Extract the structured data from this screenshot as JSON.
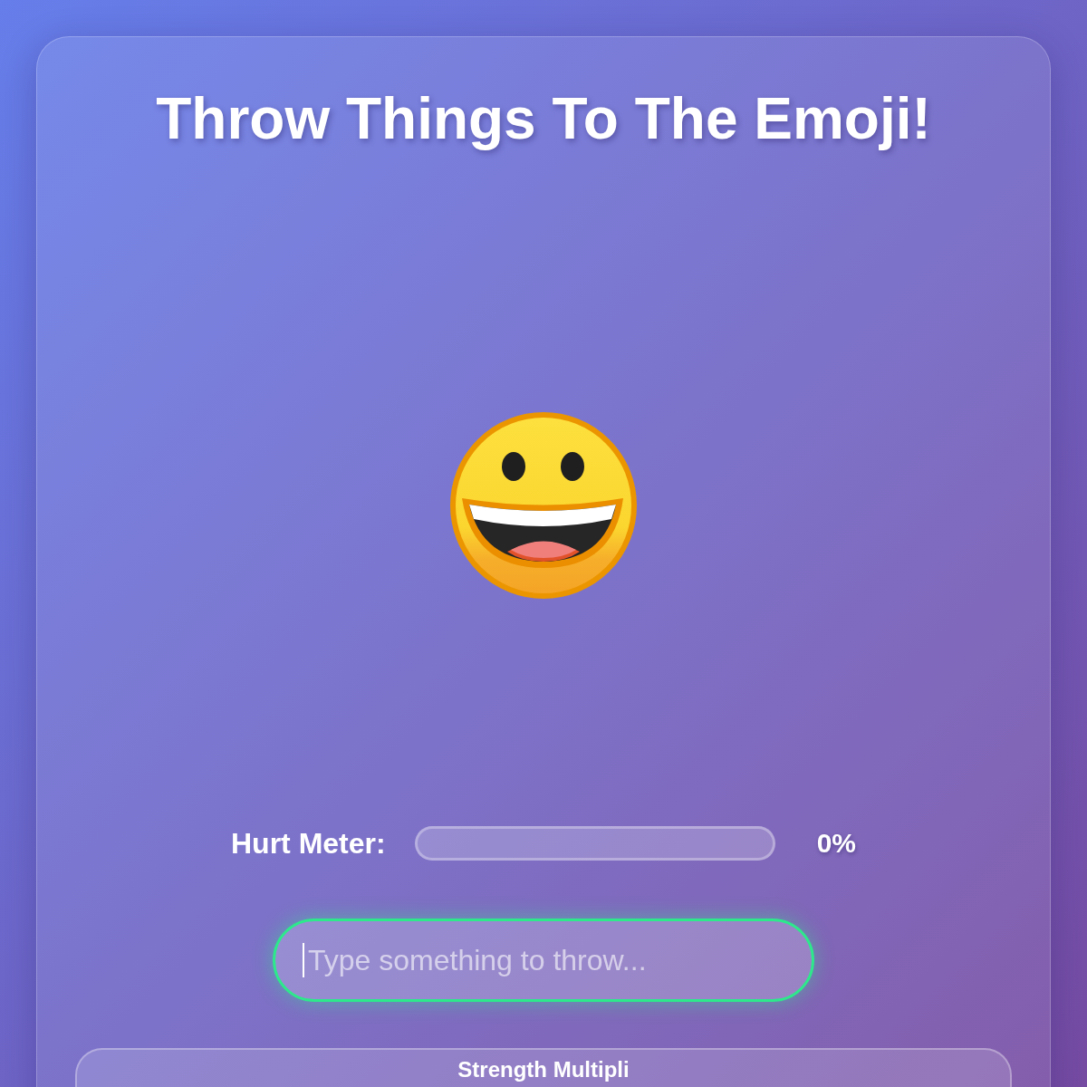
{
  "title": "Throw Things To The Emoji!",
  "hurt_meter": {
    "label": "Hurt Meter:",
    "level": 0,
    "reading": "0%"
  },
  "throw_input": {
    "placeholder": "Type something to throw...",
    "focused": true
  },
  "strength_panel": {
    "label": "Strength Multipli"
  }
}
